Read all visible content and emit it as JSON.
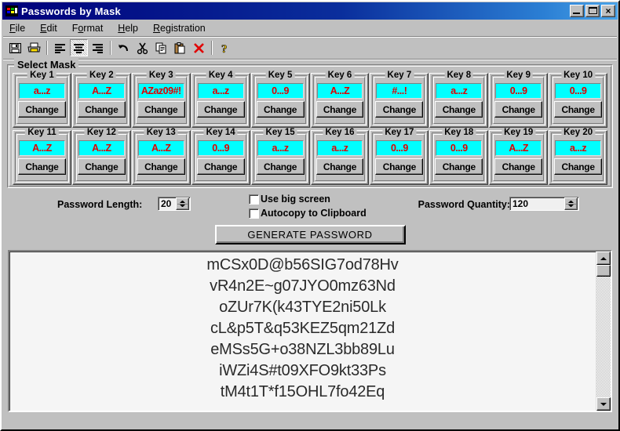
{
  "window": {
    "title": "Passwords by Mask",
    "icon": "app-palette-icon",
    "minimize_label": "_",
    "maximize_label": "□",
    "close_label": "×"
  },
  "menu": {
    "items": [
      {
        "label": "File",
        "accel": "F"
      },
      {
        "label": "Edit",
        "accel": "E"
      },
      {
        "label": "Format",
        "accel": "o"
      },
      {
        "label": "Help",
        "accel": "H"
      },
      {
        "label": "Registration",
        "accel": "R"
      }
    ]
  },
  "toolbar": {
    "buttons": [
      {
        "name": "save-icon",
        "pressed": false
      },
      {
        "name": "print-icon",
        "pressed": false
      },
      {
        "name": "align-left-icon",
        "pressed": false
      },
      {
        "name": "align-center-icon",
        "pressed": true
      },
      {
        "name": "align-right-icon",
        "pressed": false
      },
      {
        "name": "undo-icon",
        "pressed": false
      },
      {
        "name": "cut-icon",
        "pressed": false
      },
      {
        "name": "copy-icon",
        "pressed": false
      },
      {
        "name": "paste-icon",
        "pressed": false
      },
      {
        "name": "delete-icon",
        "pressed": false
      },
      {
        "name": "help-icon",
        "pressed": false
      }
    ]
  },
  "mask_group": {
    "legend": "Select Mask",
    "change_label": "Change",
    "value_bg_color": "#00ffff",
    "value_text_color": "#e00000",
    "keys": [
      {
        "title": "Key 1",
        "value": "a...z"
      },
      {
        "title": "Key 2",
        "value": "A...Z"
      },
      {
        "title": "Key 3",
        "value": "AZaz09#!"
      },
      {
        "title": "Key 4",
        "value": "a...z"
      },
      {
        "title": "Key 5",
        "value": "0...9"
      },
      {
        "title": "Key 6",
        "value": "A...Z"
      },
      {
        "title": "Key 7",
        "value": "#...!"
      },
      {
        "title": "Key 8",
        "value": "a...z"
      },
      {
        "title": "Key 9",
        "value": "0...9"
      },
      {
        "title": "Key 10",
        "value": "0...9"
      },
      {
        "title": "Key 11",
        "value": "A...Z"
      },
      {
        "title": "Key 12",
        "value": "A...Z"
      },
      {
        "title": "Key 13",
        "value": "A...Z"
      },
      {
        "title": "Key 14",
        "value": "0...9"
      },
      {
        "title": "Key 15",
        "value": "a...z"
      },
      {
        "title": "Key 16",
        "value": "a...z"
      },
      {
        "title": "Key 17",
        "value": "0...9"
      },
      {
        "title": "Key 18",
        "value": "0...9"
      },
      {
        "title": "Key 19",
        "value": "A...Z"
      },
      {
        "title": "Key 20",
        "value": "a...z"
      }
    ]
  },
  "options": {
    "password_length_label": "Password Length:",
    "password_length_value": "20",
    "password_quantity_label": "Password Quantity:",
    "password_quantity_value": "120",
    "use_big_screen_label": "Use big screen",
    "use_big_screen_checked": false,
    "autocopy_label": "Autocopy to Clipboard",
    "autocopy_checked": false,
    "generate_label": "GENERATE PASSWORD"
  },
  "output": {
    "passwords": [
      "mCSx0D@b56SIG7od78Hv",
      "vR4n2E~g07JYO0mz63Nd",
      "oZUr7K(k43TYE2ni50Lk",
      "cL&p5T&q53KEZ5qm21Zd",
      "eMSs5G+o38NZL3bb89Lu",
      "iWZi4S#t09XFO9kt33Ps",
      "tM4t1T*f15OHL7fo42Eq"
    ]
  }
}
